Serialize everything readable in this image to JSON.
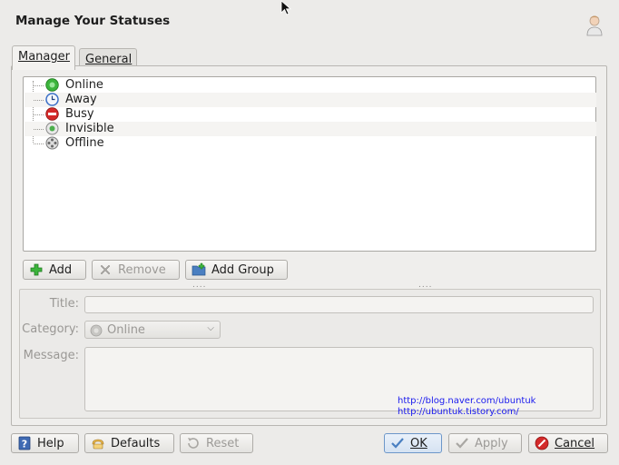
{
  "window": {
    "title": "Manage Your Statuses"
  },
  "tabs": [
    {
      "label": "Manager",
      "active": true
    },
    {
      "label": "General",
      "active": false
    }
  ],
  "statuses": [
    {
      "label": "Online",
      "icon": "online-icon",
      "color": "#2ea62e"
    },
    {
      "label": "Away",
      "icon": "away-icon",
      "color": "#3b6fc7"
    },
    {
      "label": "Busy",
      "icon": "busy-icon",
      "color": "#d22a2a"
    },
    {
      "label": "Invisible",
      "icon": "invisible-icon",
      "color": "#7a7a7a"
    },
    {
      "label": "Offline",
      "icon": "offline-icon",
      "color": "#7a7a7a"
    }
  ],
  "toolbar": {
    "add_label": "Add",
    "remove_label": "Remove",
    "add_group_label": "Add Group"
  },
  "form": {
    "title_label": "Title:",
    "title_value": "",
    "category_label": "Category:",
    "category_value": "Online",
    "message_label": "Message:",
    "message_value": ""
  },
  "watermark": {
    "line1": "http://blog.naver.com/ubuntuk",
    "line2": "http://ubuntuk.tistory.com/"
  },
  "footer": {
    "help_label": "Help",
    "defaults_label": "Defaults",
    "reset_label": "Reset",
    "ok_label": "OK",
    "apply_label": "Apply",
    "cancel_label": "Cancel"
  }
}
